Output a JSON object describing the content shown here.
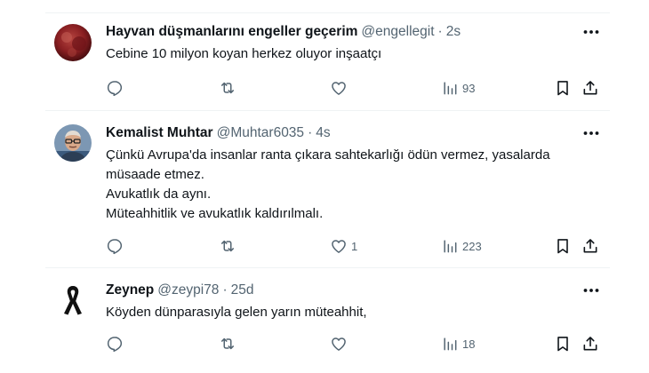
{
  "tweets": [
    {
      "name": "Hayvan düşmanlarını engeller geçerim",
      "handle": "@engellegit",
      "dot": "·",
      "time": "2s",
      "lines": [
        "Cebine 10 milyon koyan herkez oluyor inşaatçı"
      ],
      "likes": "",
      "views": "93",
      "avatar": "red-texture-avatar"
    },
    {
      "name": "Kemalist Muhtar",
      "handle": "@Muhtar6035",
      "dot": "·",
      "time": "4s",
      "lines": [
        "Çünkü Avrupa'da insanlar ranta çıkara sahtekarlığı ödün vermez, yasalarda",
        "müsaade etmez.",
        "Avukatlık da aynı.",
        "Müteahhitlik ve avukatlık kaldırılmalı."
      ],
      "likes": "1",
      "views": "223",
      "avatar": "man-with-glasses-avatar"
    },
    {
      "name": "Zeynep",
      "handle": "@zeypi78",
      "dot": "·",
      "time": "25d",
      "lines": [
        "Köyden dünparasıyla gelen yarın müteahhit,"
      ],
      "likes": "",
      "views": "18",
      "avatar": "black-ribbon-avatar"
    }
  ],
  "icons": {
    "more": "more-horizontal-icon",
    "reply": "reply-icon",
    "retweet": "retweet-icon",
    "like": "heart-icon",
    "views": "views-chart-icon",
    "bookmark": "bookmark-icon",
    "share": "share-icon"
  },
  "colors": {
    "text": "#0f1419",
    "secondary": "#536471",
    "divider": "#eff3f4"
  }
}
